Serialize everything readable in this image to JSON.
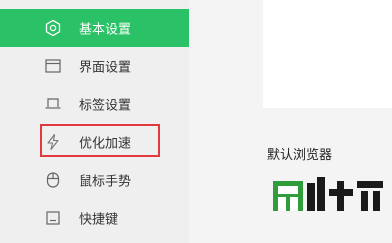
{
  "sidebar": {
    "items": [
      {
        "label": "基本设置",
        "icon": "hexagon-gear-icon",
        "active": true
      },
      {
        "label": "界面设置",
        "icon": "window-icon"
      },
      {
        "label": "标签设置",
        "icon": "tab-icon"
      },
      {
        "label": "优化加速",
        "icon": "lightning-icon",
        "highlighted": true
      },
      {
        "label": "鼠标手势",
        "icon": "mouse-icon"
      },
      {
        "label": "快捷键",
        "icon": "keyboard-icon"
      }
    ]
  },
  "main": {
    "section_title": "默认浏览器"
  },
  "colors": {
    "accent": "#2bc167",
    "highlight_border": "#e0393e",
    "watermark_green": "#2f9d3a"
  }
}
